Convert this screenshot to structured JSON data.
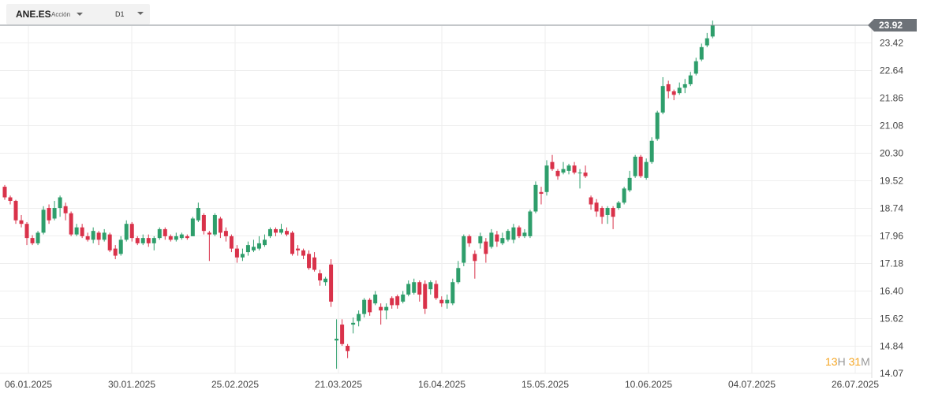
{
  "header": {
    "symbol": "ANE.ES",
    "type": "Acción",
    "timeframe": "D1"
  },
  "timer": {
    "hours": "13",
    "h_unit": "H",
    "minutes": "31",
    "m_unit": "M"
  },
  "colors": {
    "up": "#2e9e6b",
    "down": "#d9324a",
    "current_price_tag": "#6d7278",
    "grid": "#eeeeee"
  },
  "chart_data": {
    "type": "candlestick",
    "y_ticks": [
      "23.42",
      "22.64",
      "21.86",
      "21.08",
      "20.30",
      "19.52",
      "18.74",
      "17.96",
      "17.18",
      "16.40",
      "15.62",
      "14.84",
      "14.07"
    ],
    "ylim": [
      14.07,
      24.2
    ],
    "x_ticks": [
      "06.01.2025",
      "30.01.2025",
      "25.02.2025",
      "21.03.2025",
      "16.04.2025",
      "15.05.2025",
      "10.06.2025",
      "04.07.2025",
      "26.07.2025"
    ],
    "current_price": "23.92",
    "candles": [
      [
        19.35,
        19.05,
        19.4,
        18.98
      ],
      [
        19.05,
        18.95,
        19.1,
        18.85
      ],
      [
        18.95,
        18.4,
        18.98,
        18.3
      ],
      [
        18.4,
        18.3,
        18.55,
        18.2
      ],
      [
        18.3,
        17.9,
        18.35,
        17.7
      ],
      [
        17.9,
        17.75,
        17.98,
        17.7
      ],
      [
        17.75,
        18.05,
        18.1,
        17.7
      ],
      [
        18.05,
        18.7,
        18.8,
        18.0
      ],
      [
        18.75,
        18.4,
        18.85,
        18.3
      ],
      [
        18.45,
        18.75,
        18.95,
        18.4
      ],
      [
        18.75,
        19.05,
        19.1,
        18.5
      ],
      [
        18.8,
        18.6,
        18.9,
        18.4
      ],
      [
        18.6,
        18.0,
        18.65,
        17.95
      ],
      [
        18.0,
        18.2,
        18.3,
        17.95
      ],
      [
        18.2,
        17.95,
        18.3,
        17.9
      ],
      [
        17.95,
        17.85,
        18.05,
        17.8
      ],
      [
        17.85,
        18.1,
        18.2,
        17.75
      ],
      [
        18.05,
        17.85,
        18.1,
        17.7
      ],
      [
        17.85,
        18.05,
        18.15,
        17.8
      ],
      [
        18.0,
        17.55,
        18.05,
        17.5
      ],
      [
        17.6,
        17.4,
        17.7,
        17.3
      ],
      [
        17.45,
        17.85,
        17.95,
        17.4
      ],
      [
        17.85,
        18.3,
        18.4,
        17.8
      ],
      [
        18.3,
        17.9,
        18.35,
        17.8
      ],
      [
        17.9,
        17.75,
        17.95,
        17.7
      ],
      [
        17.75,
        17.9,
        18.0,
        17.7
      ],
      [
        17.9,
        17.75,
        18.0,
        17.65
      ],
      [
        17.75,
        17.9,
        17.95,
        17.55
      ],
      [
        17.9,
        18.15,
        18.2,
        17.85
      ],
      [
        18.15,
        17.95,
        18.2,
        17.85
      ],
      [
        17.95,
        17.85,
        18.0,
        17.8
      ],
      [
        17.85,
        17.95,
        18.05,
        17.8
      ],
      [
        17.9,
        18.0,
        18.05,
        17.85
      ],
      [
        17.95,
        17.9,
        18.0,
        17.85
      ],
      [
        17.95,
        18.45,
        18.5,
        17.95
      ],
      [
        18.4,
        18.75,
        18.9,
        18.35
      ],
      [
        18.55,
        18.1,
        18.6,
        18.0
      ],
      [
        18.05,
        18.0,
        18.1,
        17.25
      ],
      [
        18.0,
        18.55,
        18.6,
        17.95
      ],
      [
        18.45,
        18.05,
        18.5,
        17.9
      ],
      [
        18.1,
        17.95,
        18.2,
        17.8
      ],
      [
        17.95,
        17.6,
        18.0,
        17.5
      ],
      [
        17.6,
        17.35,
        17.7,
        17.2
      ],
      [
        17.35,
        17.45,
        17.6,
        17.25
      ],
      [
        17.5,
        17.7,
        17.8,
        17.4
      ],
      [
        17.55,
        17.65,
        17.85,
        17.5
      ],
      [
        17.6,
        17.75,
        17.95,
        17.55
      ],
      [
        17.7,
        17.85,
        18.0,
        17.65
      ],
      [
        17.95,
        18.15,
        18.2,
        17.9
      ],
      [
        18.15,
        18.05,
        18.2,
        17.95
      ],
      [
        18.05,
        18.15,
        18.3,
        18.0
      ],
      [
        18.1,
        18.0,
        18.2,
        17.95
      ],
      [
        18.05,
        17.45,
        18.1,
        17.4
      ],
      [
        17.6,
        17.55,
        17.7,
        17.4
      ],
      [
        17.55,
        17.4,
        17.6,
        17.3
      ],
      [
        17.45,
        17.05,
        17.55,
        17.0
      ],
      [
        17.35,
        17.0,
        17.5,
        16.95
      ],
      [
        16.9,
        16.7,
        17.0,
        16.55
      ],
      [
        16.65,
        16.75,
        16.8,
        16.55
      ],
      [
        17.15,
        16.1,
        17.3,
        15.95
      ],
      [
        15.0,
        15.05,
        15.6,
        14.2
      ],
      [
        15.45,
        14.9,
        15.6,
        14.85
      ],
      [
        14.85,
        14.7,
        14.9,
        14.5
      ],
      [
        15.45,
        15.5,
        15.65,
        15.2
      ],
      [
        15.55,
        15.75,
        15.85,
        15.4
      ],
      [
        15.75,
        16.15,
        16.2,
        15.65
      ],
      [
        16.15,
        15.8,
        16.2,
        15.7
      ],
      [
        16.05,
        16.3,
        16.4,
        16.0
      ],
      [
        15.95,
        15.85,
        16.05,
        15.45
      ],
      [
        15.85,
        15.95,
        16.05,
        15.6
      ],
      [
        16.2,
        16.0,
        16.25,
        15.9
      ],
      [
        16.25,
        16.0,
        16.3,
        15.9
      ],
      [
        16.1,
        16.3,
        16.4,
        16.05
      ],
      [
        16.3,
        16.6,
        16.7,
        16.25
      ],
      [
        16.35,
        16.65,
        16.75,
        16.3
      ],
      [
        16.65,
        16.3,
        16.7,
        16.1
      ],
      [
        16.6,
        15.9,
        16.7,
        15.75
      ],
      [
        16.45,
        16.65,
        16.7,
        16.3
      ],
      [
        16.6,
        16.2,
        16.7,
        16.15
      ],
      [
        16.15,
        16.05,
        16.25,
        15.95
      ],
      [
        16.05,
        16.15,
        16.3,
        15.9
      ],
      [
        16.05,
        16.65,
        16.75,
        16.0
      ],
      [
        16.65,
        17.05,
        17.25,
        16.6
      ],
      [
        17.2,
        17.95,
        18.0,
        17.1
      ],
      [
        17.95,
        17.75,
        18.0,
        17.65
      ],
      [
        17.45,
        17.25,
        17.55,
        16.75
      ],
      [
        17.75,
        17.95,
        18.05,
        17.6
      ],
      [
        17.8,
        17.45,
        17.9,
        17.2
      ],
      [
        17.65,
        18.05,
        18.15,
        17.6
      ],
      [
        18.0,
        17.8,
        18.1,
        17.65
      ],
      [
        17.75,
        17.9,
        18.05,
        17.7
      ],
      [
        17.85,
        18.1,
        18.15,
        17.8
      ],
      [
        17.85,
        18.2,
        18.3,
        17.75
      ],
      [
        18.2,
        17.95,
        18.25,
        17.9
      ],
      [
        17.95,
        18.05,
        18.15,
        17.9
      ],
      [
        17.95,
        18.65,
        18.7,
        17.9
      ],
      [
        18.65,
        19.4,
        19.5,
        18.6
      ],
      [
        19.2,
        19.15,
        19.35,
        18.85
      ],
      [
        19.2,
        19.95,
        20.1,
        19.1
      ],
      [
        20.05,
        19.85,
        20.25,
        19.8
      ],
      [
        19.8,
        19.65,
        19.85,
        19.55
      ],
      [
        19.75,
        19.85,
        20.05,
        19.7
      ],
      [
        19.8,
        19.95,
        20.0,
        19.7
      ],
      [
        19.95,
        19.75,
        20.05,
        19.7
      ],
      [
        19.75,
        19.75,
        19.85,
        19.3
      ],
      [
        19.75,
        19.65,
        19.95,
        19.6
      ],
      [
        19.05,
        18.85,
        19.1,
        18.7
      ],
      [
        18.9,
        18.65,
        19.0,
        18.5
      ],
      [
        18.75,
        18.5,
        18.8,
        18.3
      ],
      [
        18.55,
        18.75,
        18.8,
        18.3
      ],
      [
        18.75,
        18.5,
        18.8,
        18.15
      ],
      [
        18.75,
        18.9,
        18.95,
        18.7
      ],
      [
        18.9,
        19.3,
        19.35,
        18.85
      ],
      [
        19.25,
        19.6,
        19.8,
        19.2
      ],
      [
        19.65,
        20.2,
        20.25,
        19.6
      ],
      [
        20.2,
        19.65,
        20.25,
        19.6
      ],
      [
        19.6,
        20.05,
        20.15,
        19.55
      ],
      [
        20.05,
        20.65,
        20.75,
        20.0
      ],
      [
        20.7,
        21.45,
        21.5,
        20.65
      ],
      [
        21.45,
        22.2,
        22.45,
        21.4
      ],
      [
        22.25,
        22.05,
        22.35,
        21.85
      ],
      [
        22.05,
        21.95,
        22.1,
        21.8
      ],
      [
        22.0,
        22.15,
        22.3,
        21.95
      ],
      [
        22.15,
        22.25,
        22.4,
        22.0
      ],
      [
        22.25,
        22.5,
        22.6,
        22.2
      ],
      [
        22.55,
        22.9,
        23.0,
        22.5
      ],
      [
        22.95,
        23.3,
        23.4,
        22.9
      ],
      [
        23.35,
        23.55,
        23.7,
        23.3
      ],
      [
        23.6,
        23.92,
        24.05,
        23.55
      ]
    ]
  }
}
